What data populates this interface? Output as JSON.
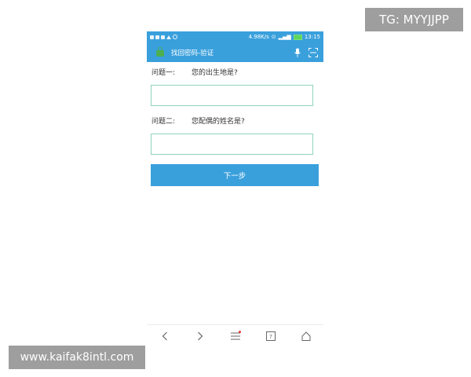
{
  "status_bar": {
    "network_speed": "4.98K/s",
    "time": "13:15"
  },
  "url_bar": {
    "title": "找回密码-验证"
  },
  "form": {
    "question1_label": "问题一:",
    "question1_text": "您的出生地是?",
    "answer1_value": "",
    "question2_label": "问题二:",
    "question2_text": "您配偶的姓名是?",
    "answer2_value": "",
    "next_button": "下一步"
  },
  "bottom_nav": {
    "tabs_count": "7"
  },
  "overlays": {
    "tg_watermark": "TG: MYYJJPP",
    "site_watermark": "www.kaifak8intl.com"
  },
  "colors": {
    "accent": "#3aa0dc",
    "input_border": "#8fd3b8",
    "lock": "#4caf50"
  }
}
